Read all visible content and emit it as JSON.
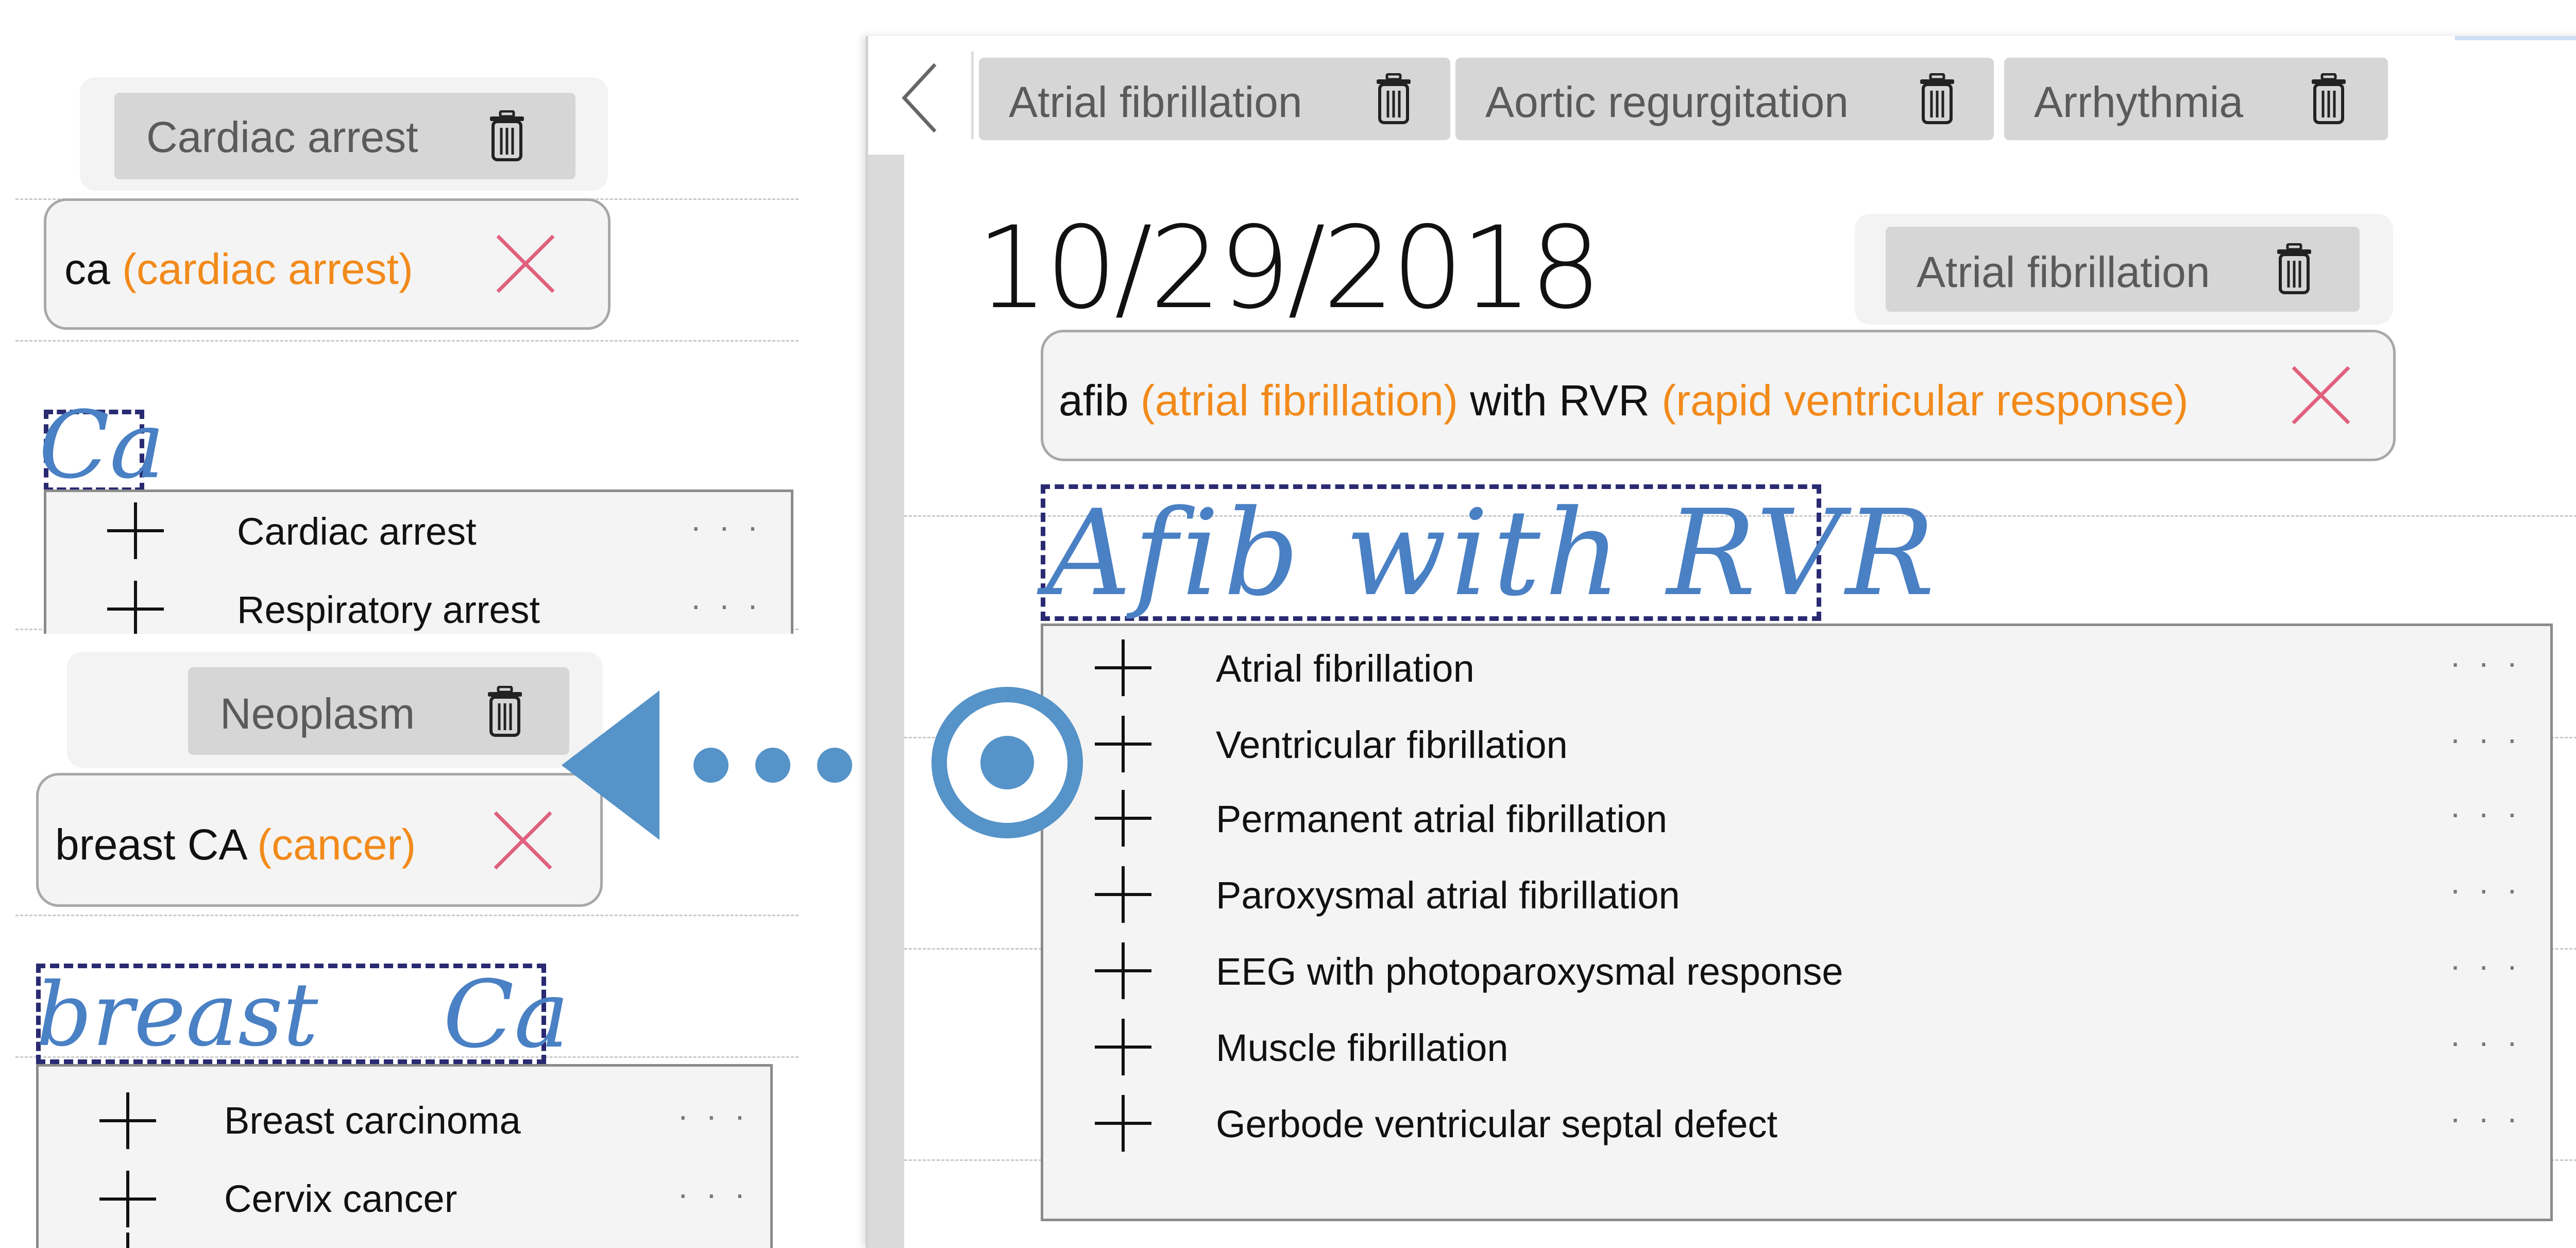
{
  "left_panel": {
    "cardiac_tag": "Cardiac arrest",
    "cardiac_interp": {
      "abbr": "ca ",
      "expansion": "(cardiac arrest)"
    },
    "cardiac_handwriting": "Ca",
    "cardiac_suggestions": [
      "Cardiac arrest",
      "Respiratory arrest"
    ],
    "neoplasm_tag": "Neoplasm",
    "breast_interp": {
      "abbr": "breast CA ",
      "expansion": "(cancer)"
    },
    "breast_handwriting_1": "breast",
    "breast_handwriting_2": "Ca",
    "breast_suggestions": [
      "Breast carcinoma",
      "Cervix cancer"
    ]
  },
  "notebook": {
    "tabs": [
      "Atrial fibrillation",
      "Aortic regurgitation",
      "Arrhythmia"
    ],
    "date": "10/29/2018",
    "afib_tag": "Atrial fibrillation",
    "afib_interp": {
      "abbr1": "afib ",
      "exp1": "(atrial fibrillation)",
      "mid": " with RVR ",
      "exp2": "(rapid ventricular response)"
    },
    "handwriting": "Afib with RVR",
    "suggestions": [
      "Atrial fibrillation",
      "Ventricular fibrillation",
      "Permanent atrial fibrillation",
      "Paroxysmal atrial fibrillation",
      "EEG with photoparoxysmal response",
      "Muscle fibrillation",
      "Gerbode ventricular septal defect"
    ],
    "more_glyph": "· · ·"
  },
  "colors": {
    "expansion_orange": "#f28a1a",
    "ink_blue": "#4a80c4",
    "arrow_blue": "#5593c8",
    "close_pink": "#e0607e",
    "selection_navy": "#2a2a72"
  },
  "icons": [
    "trash-icon",
    "close-icon",
    "plus-icon",
    "more-icon",
    "back-chevron-icon",
    "target-icon",
    "arrow-left-icon"
  ]
}
